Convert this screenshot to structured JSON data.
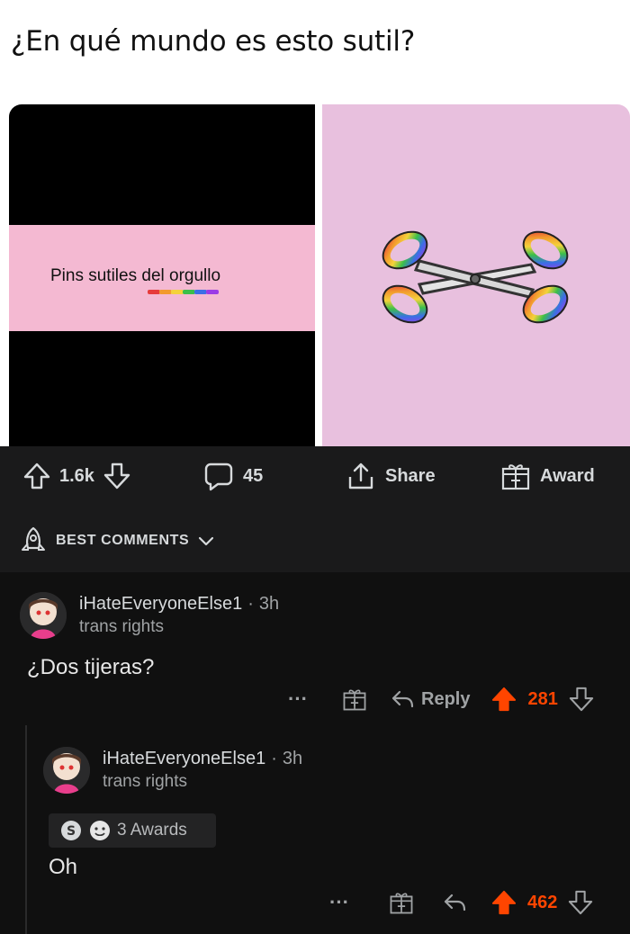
{
  "post": {
    "title": "¿En qué mundo es esto sutil?",
    "meme_caption": "Pins sutiles del orgullo"
  },
  "actions": {
    "upvotes": "1.6k",
    "comments": "45",
    "share_label": "Share",
    "award_label": "Award"
  },
  "sort": {
    "label": "BEST COMMENTS"
  },
  "comments": [
    {
      "username": "iHateEveryoneElse1",
      "time": "3h",
      "flair": "trans rights",
      "body": "¿Dos tijeras?",
      "reply_label": "Reply",
      "score": "281"
    },
    {
      "username": "iHateEveryoneElse1",
      "time": "3h",
      "flair": "trans rights",
      "awards": "3 Awards",
      "body": "Oh",
      "score": "462"
    }
  ],
  "colors": {
    "accent": "#ff4500",
    "background": "#1a1a1b",
    "meme_pink": "#f4b9d2"
  }
}
